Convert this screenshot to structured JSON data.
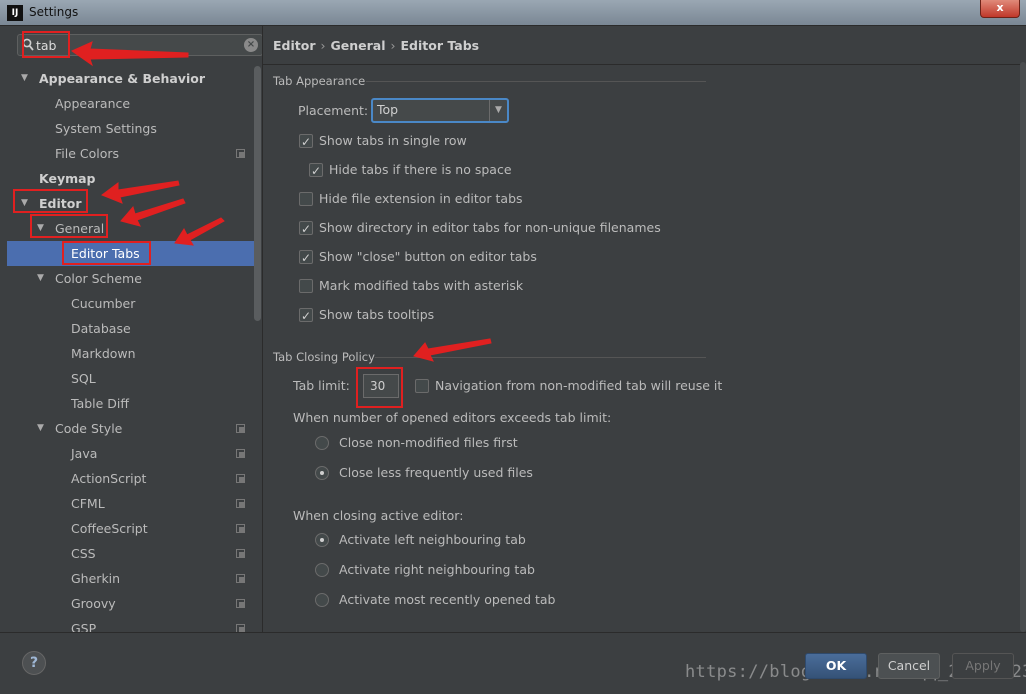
{
  "window": {
    "title": "Settings",
    "app_icon": "IJ",
    "close_label": "x"
  },
  "search": {
    "value": "tab",
    "clear": "×"
  },
  "tree": {
    "appearance_behavior": "Appearance & Behavior",
    "appearance": "Appearance",
    "system_settings": "System Settings",
    "file_colors": "File Colors",
    "keymap": "Keymap",
    "editor": "Editor",
    "general": "General",
    "editor_tabs": "Editor Tabs",
    "color_scheme": "Color Scheme",
    "cucumber": "Cucumber",
    "database": "Database",
    "markdown": "Markdown",
    "sql": "SQL",
    "table_diff": "Table Diff",
    "code_style": "Code Style",
    "java": "Java",
    "actionscript": "ActionScript",
    "cfml": "CFML",
    "coffeescript": "CoffeeScript",
    "css": "CSS",
    "gherkin": "Gherkin",
    "groovy": "Groovy",
    "gsp": "GSP"
  },
  "breadcrumb": {
    "part1": "Editor",
    "part2": "General",
    "part3": "Editor Tabs",
    "sep": "›"
  },
  "tab_appearance": {
    "title": "Tab Appearance",
    "placement_label": "Placement:",
    "placement_value": "Top",
    "show_single_row": "Show tabs in single row",
    "hide_no_space": "Hide tabs if there is no space",
    "hide_extension": "Hide file extension in editor tabs",
    "show_directory": "Show directory in editor tabs for non-unique filenames",
    "show_close": "Show \"close\" button on editor tabs",
    "mark_modified": "Mark modified tabs with asterisk",
    "show_tooltips": "Show tabs tooltips"
  },
  "tab_closing": {
    "title": "Tab Closing Policy",
    "limit_label": "Tab limit:",
    "limit_value": "30",
    "nav_reuse": "Navigation from non-modified tab will reuse it",
    "exceeds_label": "When number of opened editors exceeds tab limit:",
    "close_non_modified": "Close non-modified files first",
    "close_less_frequent": "Close less frequently used files",
    "active_label": "When closing active editor:",
    "activate_left": "Activate left neighbouring tab",
    "activate_right": "Activate right neighbouring tab",
    "activate_recent": "Activate most recently opened tab"
  },
  "buttons": {
    "help": "?",
    "ok": "OK",
    "cancel": "Cancel",
    "apply": "Apply"
  },
  "watermark": "https://blog.csdn.net/qq_25112523"
}
